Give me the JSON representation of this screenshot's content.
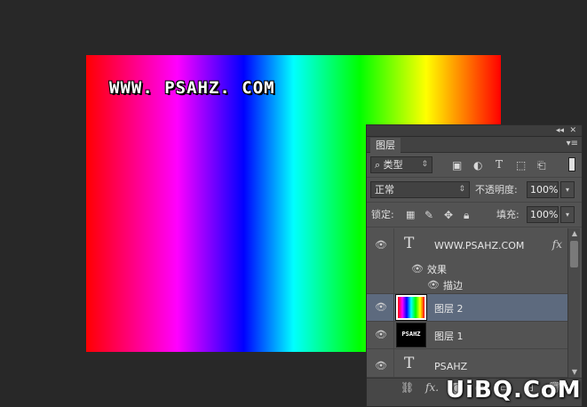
{
  "canvas": {
    "text": "WWW. PSAHZ. COM",
    "colors": {
      "text": "#ffffff",
      "outline": "#000000",
      "gradient": [
        "#ff0000",
        "#ff00ff",
        "#0000ff",
        "#00ffff",
        "#00ff00",
        "#ffff00",
        "#ff0000"
      ]
    }
  },
  "panel": {
    "tab_label": "图层",
    "filter": {
      "icon": "search-icon",
      "kind_label": "类型",
      "filter_icons": [
        "image-filter-icon",
        "adjustment-filter-icon",
        "type-filter-icon",
        "shape-filter-icon",
        "smartobject-filter-icon"
      ]
    },
    "blend": {
      "mode": "正常",
      "opacity_label": "不透明度:",
      "opacity_value": "100%"
    },
    "lock": {
      "label": "锁定:",
      "icons": [
        "lock-transparent-icon",
        "lock-paint-icon",
        "lock-move-icon",
        "lock-all-icon"
      ],
      "fill_label": "填充:",
      "fill_value": "100%"
    },
    "layers": [
      {
        "name": "WWW.PSAHZ.COM",
        "type": "text",
        "fx": "fx"
      },
      {
        "effects_label": "效果",
        "stroke_label": "描边"
      },
      {
        "name": "图层 2",
        "type": "gradient",
        "selected": true
      },
      {
        "name": "图层 1",
        "type": "image",
        "thumb_text": "PSAHZ"
      },
      {
        "name": "PSAHZ",
        "type": "text"
      }
    ],
    "bottom_icons": [
      "link-layers-icon",
      "fx-icon",
      "mask-icon",
      "adjustment-icon",
      "folder-icon",
      "new-layer-icon",
      "trash-icon"
    ],
    "bottom_fx_label": "fx.",
    "colors": {
      "panel_bg": "#535353",
      "selected_row": "#5d6a7e",
      "dark": "#3d3d3d"
    }
  },
  "watermark": "UiBQ.CoM"
}
